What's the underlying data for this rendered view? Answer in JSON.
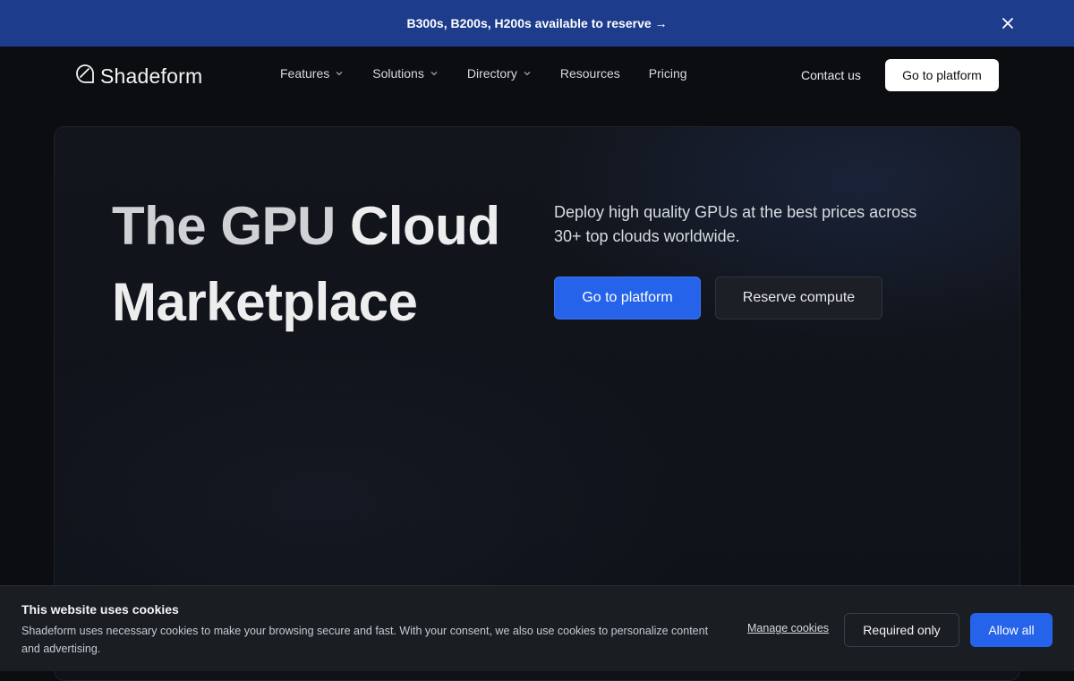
{
  "banner": {
    "text": "B300s, B200s, H200s available to reserve →",
    "close_icon": "close-icon"
  },
  "nav": {
    "logo_text": "Shadeform",
    "logo_icon": "shadeform-logo-icon",
    "items": [
      {
        "label": "Features",
        "has_dropdown": true
      },
      {
        "label": "Solutions",
        "has_dropdown": true
      },
      {
        "label": "Directory",
        "has_dropdown": true
      },
      {
        "label": "Resources",
        "has_dropdown": false
      },
      {
        "label": "Pricing",
        "has_dropdown": false
      }
    ],
    "contact_label": "Contact us",
    "cta_label": "Go to platform"
  },
  "hero": {
    "title_part1": "The GPU ",
    "title_part2": "Cloud Marketplace",
    "subtitle": "Deploy high quality GPUs at the best prices across 30+ top clouds worldwide.",
    "primary_button": "Go to platform",
    "secondary_button": "Reserve compute"
  },
  "cookie": {
    "title": "This website uses cookies",
    "text": "Shadeform uses necessary cookies to make your browsing secure and fast. With your consent, we also use cookies to personalize content and advertising.",
    "manage_label": "Manage cookies",
    "required_label": "Required only",
    "allow_label": "Allow all"
  },
  "colors": {
    "banner_bg": "#1e3c8c",
    "accent": "#2563eb",
    "page_bg": "#0b0d10"
  }
}
